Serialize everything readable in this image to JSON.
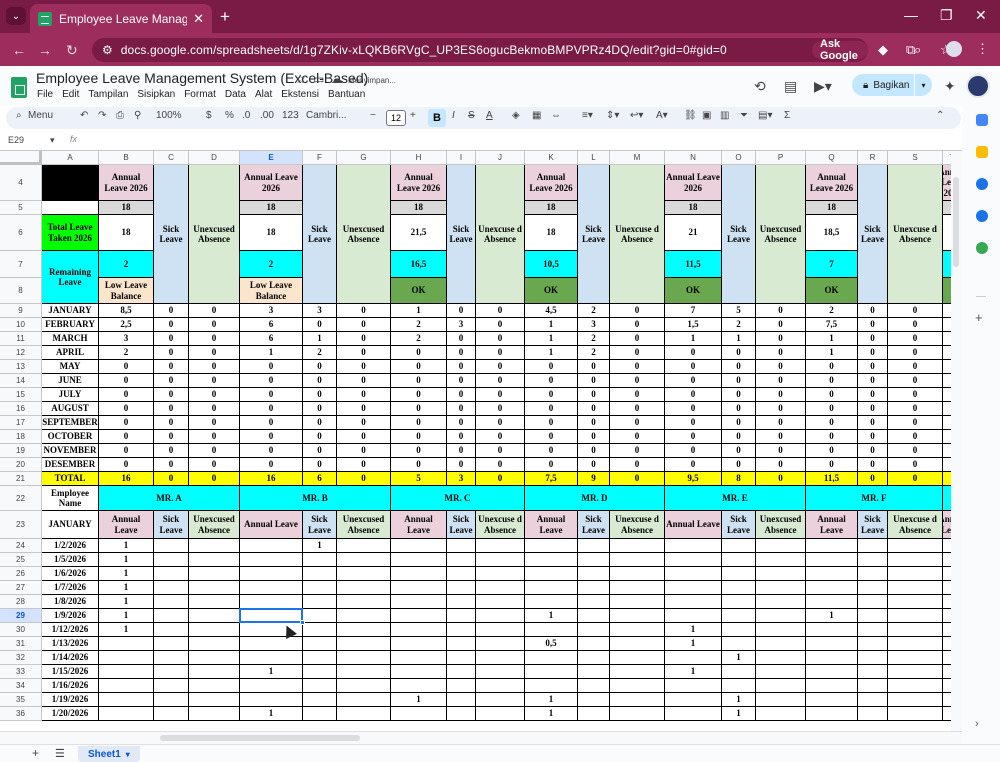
{
  "browser": {
    "tab_title": "Employee Leave Management S",
    "url": "docs.google.com/spreadsheets/d/1g7ZKiv-xLQKB6RVgC_UP3ES6ogucBekmoBMPVPRz4DQ/edit?gid=0#gid=0",
    "ask_label": "Ask Google"
  },
  "doc": {
    "title": "Employee Leave Management System (Excel-Based)",
    "saving": "Menyimpan...",
    "menus": [
      "File",
      "Edit",
      "Tampilan",
      "Sisipkan",
      "Format",
      "Data",
      "Alat",
      "Ekstensi",
      "Bantuan"
    ],
    "share_label": "Bagikan"
  },
  "toolbar": {
    "menu_label": "Menu",
    "zoom": "100%",
    "currency": "$",
    "percent": "%",
    "dec_less": ".0",
    "dec_more": ".00",
    "numfmt": "123",
    "font": "Cambri...",
    "font_size": "12",
    "bold": "B",
    "italic": "I",
    "strike": "S",
    "textcolor": "A"
  },
  "formula_bar": {
    "cell_ref": "E29",
    "fx": "fx",
    "value": ""
  },
  "sheet_tab": "Sheet1",
  "colors": {
    "lilac": "#ead1dc",
    "lightblue": "#cfe2f3",
    "lightgreen": "#d9ead3",
    "cyan": "#00ffff",
    "green": "#00ff00",
    "yellow": "#ffff00",
    "ok": "#6aa84f",
    "peach": "#fce5cd",
    "grey": "#d9d9d9"
  },
  "columns": [
    "A",
    "B",
    "C",
    "D",
    "E",
    "F",
    "G",
    "H",
    "I",
    "J",
    "K",
    "L",
    "M",
    "N",
    "O",
    "P",
    "Q",
    "R",
    "S",
    "T"
  ],
  "rows": [
    "4",
    "5",
    "6",
    "7",
    "8",
    "9",
    "10",
    "11",
    "12",
    "13",
    "14",
    "15",
    "16",
    "17",
    "18",
    "19",
    "20",
    "21",
    "22",
    "23",
    "24",
    "25",
    "26",
    "27",
    "28",
    "29",
    "30",
    "31",
    "32",
    "33",
    "34",
    "35",
    "36"
  ],
  "labels": {
    "annual_leave": "Annual Leave 2026",
    "annual_leave_short": "Annual Leave",
    "sick": "Sick Leave",
    "unexcused": "Unexcused Absence",
    "unexcused_wrap": "Unexcuse d Absence",
    "total_taken": "Total Leave Taken 2026",
    "remaining": "Remaining Leave",
    "total": "TOTAL",
    "emp_name": "Employee Name",
    "january_hdr": "JANUARY"
  },
  "entitlement": [
    "18",
    "18",
    "18",
    "18",
    "18",
    "18"
  ],
  "taken": [
    "18",
    "18",
    "21,5",
    "18",
    "21",
    "18,5"
  ],
  "remaining": [
    "2",
    "2",
    "16,5",
    "10,5",
    "11,5",
    "7"
  ],
  "status": [
    "Low Leave Balance",
    "Low Leave Balance",
    "OK",
    "OK",
    "OK",
    "OK"
  ],
  "months": [
    "JANUARY",
    "FEBRUARY",
    "MARCH",
    "APRIL",
    "MAY",
    "JUNE",
    "JULY",
    "AUGUST",
    "SEPTEMBER",
    "OCTOBER",
    "NOVEMBER",
    "DESEMBER"
  ],
  "monthly": [
    [
      "8,5",
      "0",
      "0",
      "3",
      "3",
      "0",
      "1",
      "0",
      "0",
      "4,5",
      "2",
      "0",
      "7",
      "5",
      "0",
      "2",
      "0",
      "0"
    ],
    [
      "2,5",
      "0",
      "0",
      "6",
      "0",
      "0",
      "2",
      "3",
      "0",
      "1",
      "3",
      "0",
      "1,5",
      "2",
      "0",
      "7,5",
      "0",
      "0"
    ],
    [
      "3",
      "0",
      "0",
      "6",
      "1",
      "0",
      "2",
      "0",
      "0",
      "1",
      "2",
      "0",
      "1",
      "1",
      "0",
      "1",
      "0",
      "0"
    ],
    [
      "2",
      "0",
      "0",
      "1",
      "2",
      "0",
      "0",
      "0",
      "0",
      "1",
      "2",
      "0",
      "0",
      "0",
      "0",
      "1",
      "0",
      "0"
    ],
    [
      "0",
      "0",
      "0",
      "0",
      "0",
      "0",
      "0",
      "0",
      "0",
      "0",
      "0",
      "0",
      "0",
      "0",
      "0",
      "0",
      "0",
      "0"
    ],
    [
      "0",
      "0",
      "0",
      "0",
      "0",
      "0",
      "0",
      "0",
      "0",
      "0",
      "0",
      "0",
      "0",
      "0",
      "0",
      "0",
      "0",
      "0"
    ],
    [
      "0",
      "0",
      "0",
      "0",
      "0",
      "0",
      "0",
      "0",
      "0",
      "0",
      "0",
      "0",
      "0",
      "0",
      "0",
      "0",
      "0",
      "0"
    ],
    [
      "0",
      "0",
      "0",
      "0",
      "0",
      "0",
      "0",
      "0",
      "0",
      "0",
      "0",
      "0",
      "0",
      "0",
      "0",
      "0",
      "0",
      "0"
    ],
    [
      "0",
      "0",
      "0",
      "0",
      "0",
      "0",
      "0",
      "0",
      "0",
      "0",
      "0",
      "0",
      "0",
      "0",
      "0",
      "0",
      "0",
      "0"
    ],
    [
      "0",
      "0",
      "0",
      "0",
      "0",
      "0",
      "0",
      "0",
      "0",
      "0",
      "0",
      "0",
      "0",
      "0",
      "0",
      "0",
      "0",
      "0"
    ],
    [
      "0",
      "0",
      "0",
      "0",
      "0",
      "0",
      "0",
      "0",
      "0",
      "0",
      "0",
      "0",
      "0",
      "0",
      "0",
      "0",
      "0",
      "0"
    ],
    [
      "0",
      "0",
      "0",
      "0",
      "0",
      "0",
      "0",
      "0",
      "0",
      "0",
      "0",
      "0",
      "0",
      "0",
      "0",
      "0",
      "0",
      "0"
    ]
  ],
  "totals": [
    "16",
    "0",
    "0",
    "16",
    "6",
    "0",
    "5",
    "3",
    "0",
    "7,5",
    "9",
    "0",
    "9,5",
    "8",
    "0",
    "11,5",
    "0",
    "0"
  ],
  "employees": [
    "MR. A",
    "MR. B",
    "MR. C",
    "MR. D",
    "MR. E",
    "MR. F"
  ],
  "dates": [
    "1/2/2026",
    "1/5/2026",
    "1/6/2026",
    "1/7/2026",
    "1/8/2026",
    "1/9/2026",
    "1/12/2026",
    "1/13/2026",
    "1/14/2026",
    "1/15/2026",
    "1/16/2026",
    "1/19/2026",
    "1/20/2026"
  ],
  "daily": [
    [
      "1",
      "",
      "",
      "",
      "1",
      "",
      "",
      "",
      "",
      "",
      "",
      "",
      "",
      "",
      "",
      "",
      "",
      ""
    ],
    [
      "1",
      "",
      "",
      "",
      "",
      "",
      "",
      "",
      "",
      "",
      "",
      "",
      "",
      "",
      "",
      "",
      "",
      ""
    ],
    [
      "1",
      "",
      "",
      "",
      "",
      "",
      "",
      "",
      "",
      "",
      "",
      "",
      "",
      "",
      "",
      "",
      "",
      ""
    ],
    [
      "1",
      "",
      "",
      "",
      "",
      "",
      "",
      "",
      "",
      "",
      "",
      "",
      "",
      "",
      "",
      "",
      "",
      ""
    ],
    [
      "1",
      "",
      "",
      "",
      "",
      "",
      "",
      "",
      "",
      "",
      "",
      "",
      "",
      "",
      "",
      "",
      "",
      ""
    ],
    [
      "1",
      "",
      "",
      "",
      "",
      "",
      "",
      "",
      "",
      "1",
      "",
      "",
      "",
      "",
      "",
      "1",
      "",
      ""
    ],
    [
      "1",
      "",
      "",
      "",
      "",
      "",
      "",
      "",
      "",
      "",
      "",
      "",
      "1",
      "",
      "",
      "",
      "",
      ""
    ],
    [
      "",
      "",
      "",
      "",
      "",
      "",
      "",
      "",
      "",
      "0,5",
      "",
      "",
      "1",
      "",
      "",
      "",
      "",
      ""
    ],
    [
      "",
      "",
      "",
      "",
      "",
      "",
      "",
      "",
      "",
      "",
      "",
      "",
      "",
      "1",
      "",
      "",
      "",
      ""
    ],
    [
      "",
      "",
      "",
      "1",
      "",
      "",
      "",
      "",
      "",
      "",
      "",
      "",
      "1",
      "",
      "",
      "",
      "",
      ""
    ],
    [
      "",
      "",
      "",
      "",
      "",
      "",
      "",
      "",
      "",
      "",
      "",
      "",
      "",
      "",
      "",
      "",
      "",
      ""
    ],
    [
      "",
      "",
      "",
      "",
      "",
      "",
      "1",
      "",
      "",
      "1",
      "",
      "",
      "",
      "1",
      "",
      "",
      "",
      ""
    ],
    [
      "",
      "",
      "",
      "1",
      "",
      "",
      "",
      "",
      "",
      "1",
      "",
      "",
      "",
      "1",
      "",
      "",
      "",
      ""
    ]
  ]
}
